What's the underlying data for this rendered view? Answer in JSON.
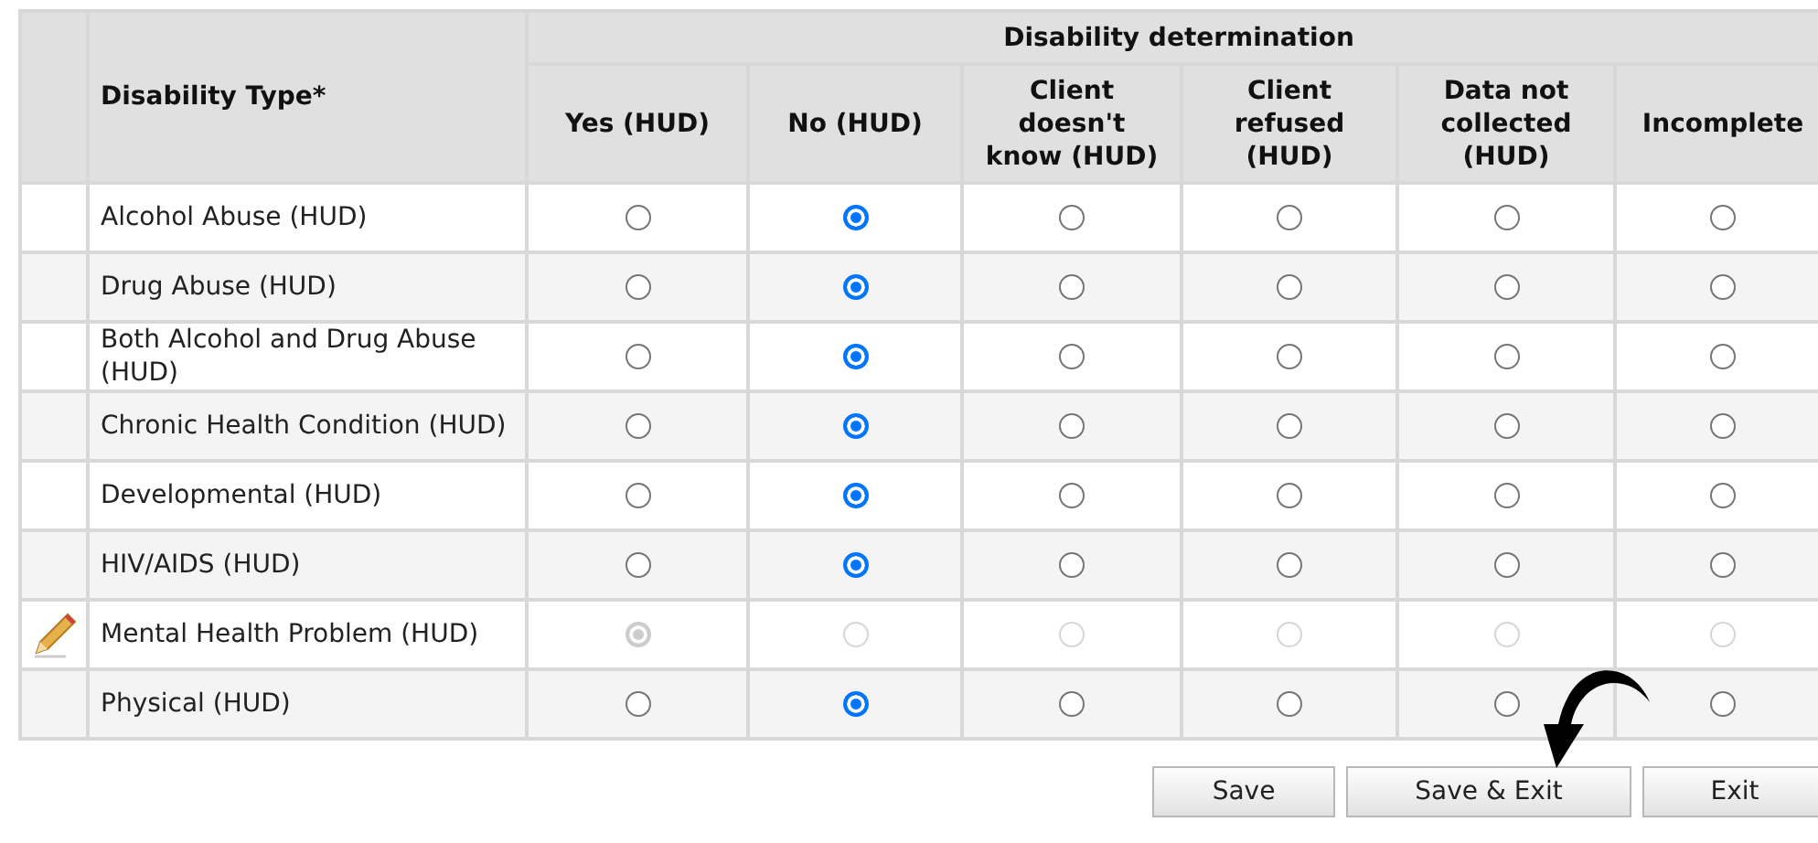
{
  "table": {
    "group_heading": "Disability determination",
    "type_heading": "Disability Type*",
    "options": [
      "Yes (HUD)",
      "No (HUD)",
      "Client doesn't know (HUD)",
      "Client refused (HUD)",
      "Data not collected (HUD)",
      "Incomplete"
    ],
    "rows": [
      {
        "label": "Alcohol Abuse (HUD)",
        "editing": false,
        "disabled": false,
        "choices": [
          {
            "selected": false
          },
          {
            "selected": true
          },
          {
            "selected": false
          },
          {
            "selected": false
          },
          {
            "selected": false
          },
          {
            "selected": false
          }
        ]
      },
      {
        "label": "Drug Abuse (HUD)",
        "editing": false,
        "disabled": false,
        "choices": [
          {
            "selected": false
          },
          {
            "selected": true
          },
          {
            "selected": false
          },
          {
            "selected": false
          },
          {
            "selected": false
          },
          {
            "selected": false
          }
        ]
      },
      {
        "label": "Both Alcohol and Drug Abuse (HUD)",
        "editing": false,
        "disabled": false,
        "choices": [
          {
            "selected": false
          },
          {
            "selected": true
          },
          {
            "selected": false
          },
          {
            "selected": false
          },
          {
            "selected": false
          },
          {
            "selected": false
          }
        ]
      },
      {
        "label": "Chronic Health Condition (HUD)",
        "editing": false,
        "disabled": false,
        "choices": [
          {
            "selected": false
          },
          {
            "selected": true
          },
          {
            "selected": false
          },
          {
            "selected": false
          },
          {
            "selected": false
          },
          {
            "selected": false
          }
        ]
      },
      {
        "label": "Developmental (HUD)",
        "editing": false,
        "disabled": false,
        "choices": [
          {
            "selected": false
          },
          {
            "selected": true
          },
          {
            "selected": false
          },
          {
            "selected": false
          },
          {
            "selected": false
          },
          {
            "selected": false
          }
        ]
      },
      {
        "label": "HIV/AIDS (HUD)",
        "editing": false,
        "disabled": false,
        "choices": [
          {
            "selected": false
          },
          {
            "selected": true
          },
          {
            "selected": false
          },
          {
            "selected": false
          },
          {
            "selected": false
          },
          {
            "selected": false
          }
        ]
      },
      {
        "label": "Mental Health Problem (HUD)",
        "editing": true,
        "disabled": true,
        "choices": [
          {
            "selected": true
          },
          {
            "selected": false
          },
          {
            "selected": false
          },
          {
            "selected": false
          },
          {
            "selected": false
          },
          {
            "selected": false
          }
        ]
      },
      {
        "label": "Physical (HUD)",
        "editing": false,
        "disabled": false,
        "choices": [
          {
            "selected": false
          },
          {
            "selected": true
          },
          {
            "selected": false
          },
          {
            "selected": false
          },
          {
            "selected": false
          },
          {
            "selected": false
          }
        ]
      }
    ]
  },
  "buttons": [
    "Save",
    "Save & Exit",
    "Exit"
  ]
}
